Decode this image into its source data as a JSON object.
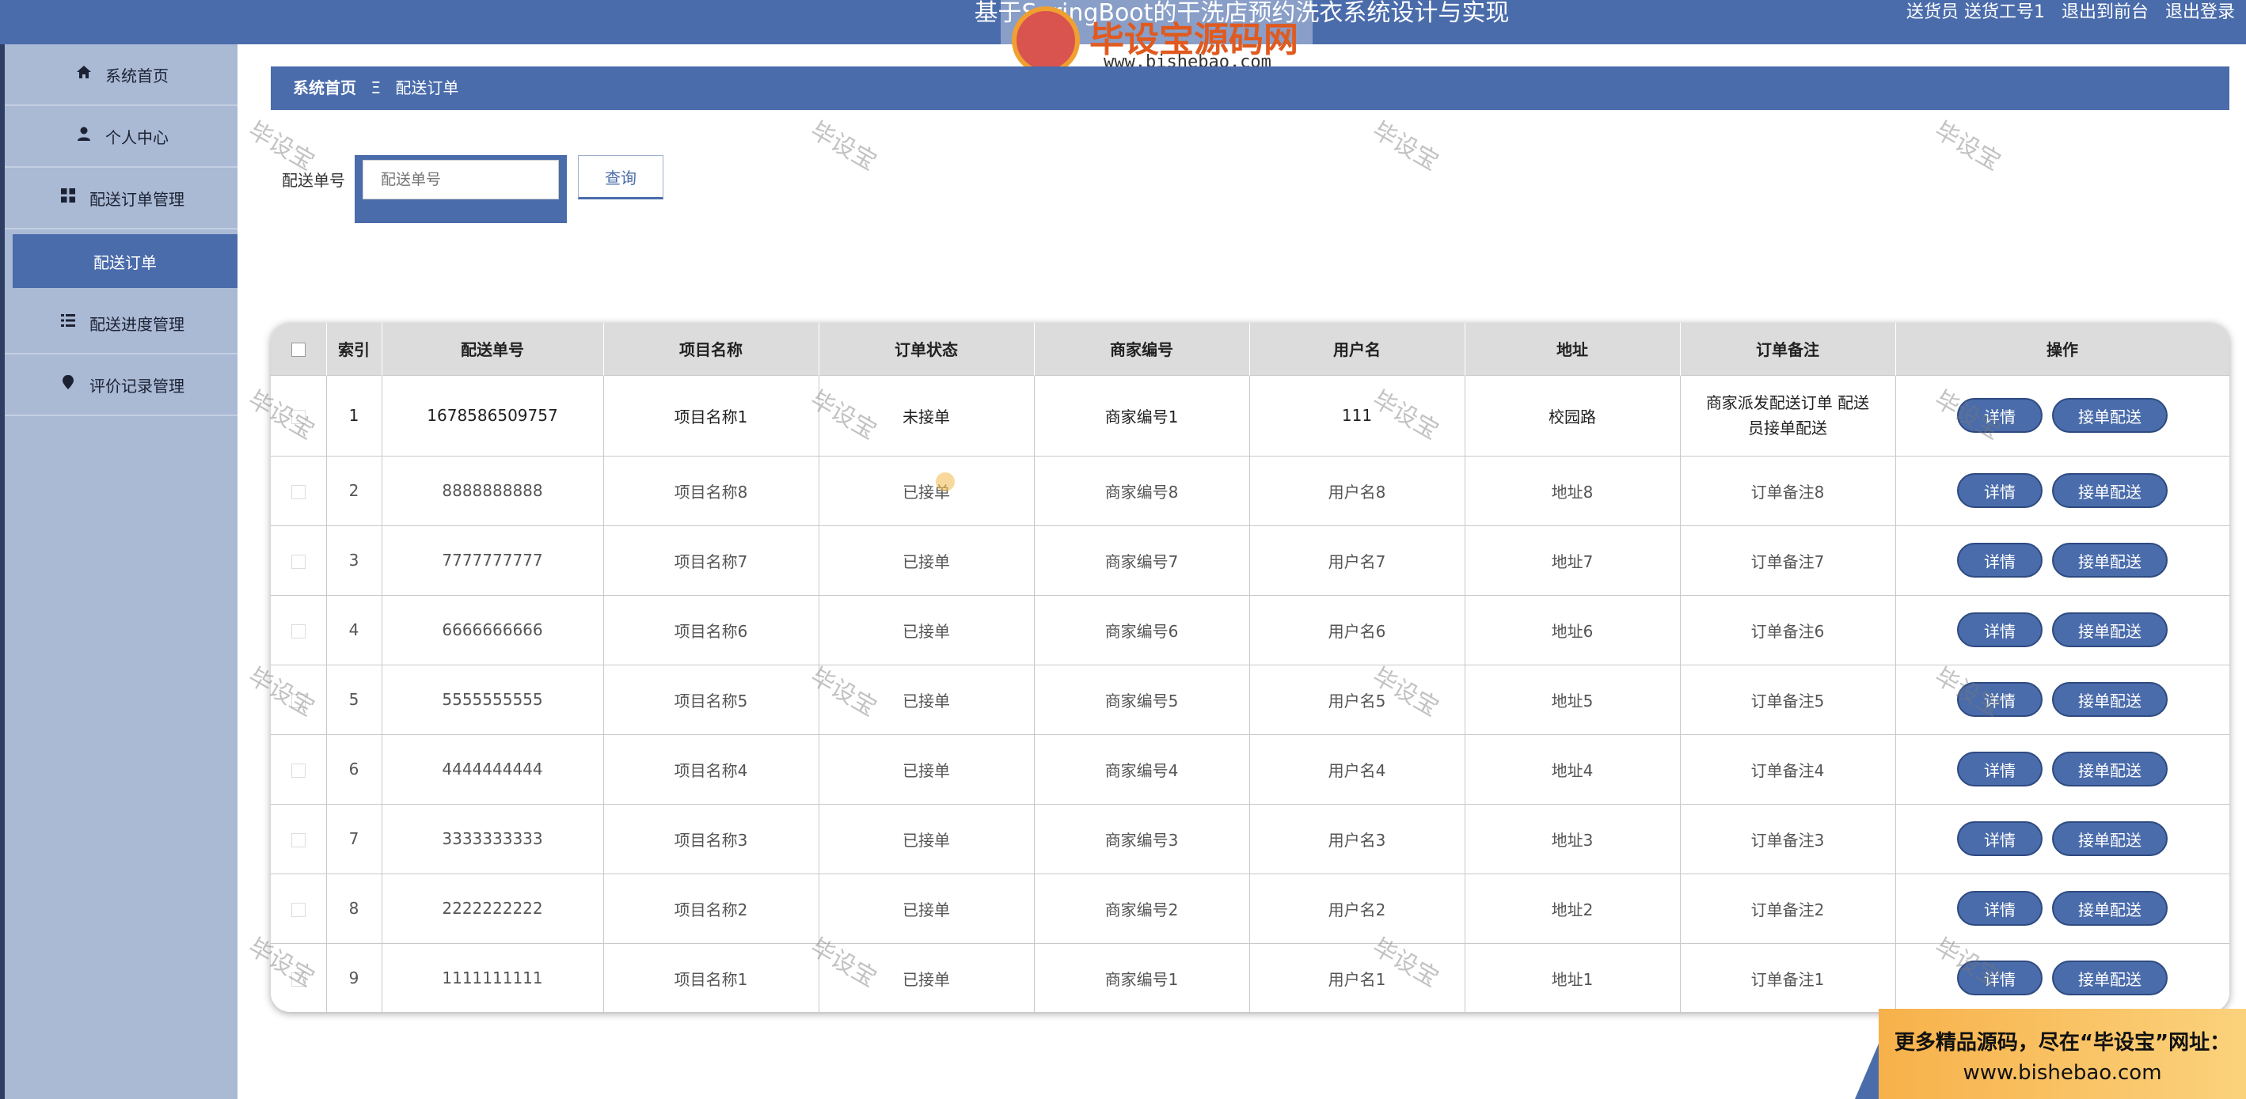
{
  "header": {
    "title": "基于SpringBoot的干洗店预约洗衣系统设计与实现",
    "user_info": "送货员 送货工号1",
    "back_to_front": "退出到前台",
    "logout": "退出登录"
  },
  "watermark": {
    "logo_text": "毕设宝源码网",
    "logo_url": "www.bishebao.com",
    "tile_text": "毕设宝"
  },
  "sidebar": {
    "items": [
      {
        "label": "系统首页",
        "icon": "home-icon"
      },
      {
        "label": "个人中心",
        "icon": "user-icon"
      },
      {
        "label": "配送订单管理",
        "icon": "grid-icon"
      },
      {
        "label": "配送订单",
        "icon": "",
        "sub": true
      },
      {
        "label": "配送进度管理",
        "icon": "list-icon"
      },
      {
        "label": "评价记录管理",
        "icon": "pin-icon"
      }
    ]
  },
  "breadcrumb": {
    "home": "系统首页",
    "separator": "Ξ",
    "current": "配送订单"
  },
  "search": {
    "label": "配送单号",
    "placeholder": "配送单号",
    "button": "查询"
  },
  "table": {
    "columns": [
      "索引",
      "配送单号",
      "项目名称",
      "订单状态",
      "商家编号",
      "用户名",
      "地址",
      "订单备注",
      "操作"
    ],
    "detail_label": "详情",
    "accept_label": "接单配送",
    "rows": [
      {
        "index": "1",
        "order_no": "1678586509757",
        "item": "项目名称1",
        "status": "未接单",
        "merchant": "商家编号1",
        "user": "111",
        "address": "校园路",
        "note": "商家派发配送订单 配送员接单配送"
      },
      {
        "index": "2",
        "order_no": "8888888888",
        "item": "项目名称8",
        "status": "已接单",
        "merchant": "商家编号8",
        "user": "用户名8",
        "address": "地址8",
        "note": "订单备注8"
      },
      {
        "index": "3",
        "order_no": "7777777777",
        "item": "项目名称7",
        "status": "已接单",
        "merchant": "商家编号7",
        "user": "用户名7",
        "address": "地址7",
        "note": "订单备注7"
      },
      {
        "index": "4",
        "order_no": "6666666666",
        "item": "项目名称6",
        "status": "已接单",
        "merchant": "商家编号6",
        "user": "用户名6",
        "address": "地址6",
        "note": "订单备注6"
      },
      {
        "index": "5",
        "order_no": "5555555555",
        "item": "项目名称5",
        "status": "已接单",
        "merchant": "商家编号5",
        "user": "用户名5",
        "address": "地址5",
        "note": "订单备注5"
      },
      {
        "index": "6",
        "order_no": "4444444444",
        "item": "项目名称4",
        "status": "已接单",
        "merchant": "商家编号4",
        "user": "用户名4",
        "address": "地址4",
        "note": "订单备注4"
      },
      {
        "index": "7",
        "order_no": "3333333333",
        "item": "项目名称3",
        "status": "已接单",
        "merchant": "商家编号3",
        "user": "用户名3",
        "address": "地址3",
        "note": "订单备注3"
      },
      {
        "index": "8",
        "order_no": "2222222222",
        "item": "项目名称2",
        "status": "已接单",
        "merchant": "商家编号2",
        "user": "用户名2",
        "address": "地址2",
        "note": "订单备注2"
      },
      {
        "index": "9",
        "order_no": "1111111111",
        "item": "项目名称1",
        "status": "已接单",
        "merchant": "商家编号1",
        "user": "用户名1",
        "address": "地址1",
        "note": "订单备注1"
      }
    ]
  },
  "ad": {
    "line1": "更多精品源码，尽在“毕设宝”网址：",
    "line2": "www.bishebao.com"
  },
  "colors": {
    "primary": "#4a6cab",
    "sidebar_bg": "#aab9d4",
    "header_row_bg": "#dcdcdc"
  }
}
